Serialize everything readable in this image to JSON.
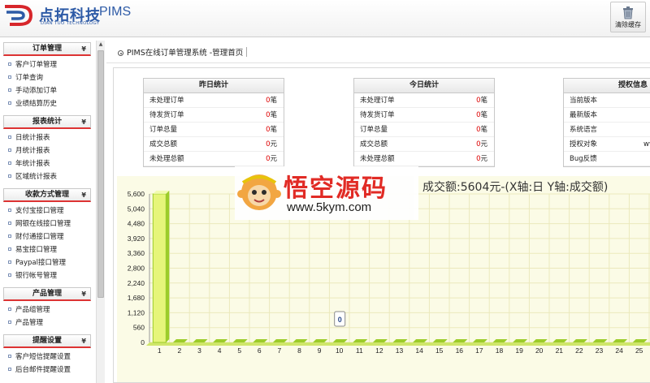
{
  "header": {
    "logo_cn": "点拓科技",
    "logo_pims": "PIMS",
    "logo_en": "DIAN TUO TECHNOLOGY",
    "clear_cache_label": "清除缓存"
  },
  "sidebar": {
    "menus": [
      {
        "title": "订单管理",
        "items": [
          "客户订单管理",
          "订单查询",
          "手动添加订单",
          "业绩结算历史"
        ]
      },
      {
        "title": "报表统计",
        "items": [
          "日统计报表",
          "月统计报表",
          "年统计报表",
          "区域统计报表"
        ]
      },
      {
        "title": "收款方式管理",
        "items": [
          "支付宝接口管理",
          "网银在线接口管理",
          "财付通接口管理",
          "易宝接口管理",
          "Paypal接口管理",
          "银行帐号管理"
        ]
      },
      {
        "title": "产品管理",
        "items": [
          "产品组管理",
          "产品管理"
        ]
      },
      {
        "title": "提醒设置",
        "items": [
          "客户短信提醒设置",
          "后台邮件提醒设置"
        ]
      }
    ]
  },
  "main": {
    "breadcrumb": "PIMS在线订单管理系统 -管理首页",
    "yesterday": {
      "title": "昨日统计",
      "rows": [
        {
          "label": "未处理订单",
          "num": "0",
          "unit": "笔"
        },
        {
          "label": "待发货订单",
          "num": "0",
          "unit": "笔"
        },
        {
          "label": "订单总量",
          "num": "0",
          "unit": "笔"
        },
        {
          "label": "成交总额",
          "num": "0",
          "unit": "元"
        },
        {
          "label": "未处理总额",
          "num": "0",
          "unit": "元"
        }
      ]
    },
    "today": {
      "title": "今日统计",
      "rows": [
        {
          "label": "未处理订单",
          "num": "0",
          "unit": "笔"
        },
        {
          "label": "待发货订单",
          "num": "0",
          "unit": "笔"
        },
        {
          "label": "订单总量",
          "num": "0",
          "unit": "笔"
        },
        {
          "label": "成交总额",
          "num": "0",
          "unit": "元"
        },
        {
          "label": "未处理总额",
          "num": "0",
          "unit": "元"
        }
      ]
    },
    "license": {
      "title": "授权信息",
      "rows": [
        {
          "label": "当前版本",
          "value": ""
        },
        {
          "label": "最新版本",
          "value": ""
        },
        {
          "label": "系统语言",
          "value": ""
        },
        {
          "label": "授权对象",
          "value": "ww"
        },
        {
          "label": "Bug反馈",
          "value": ""
        }
      ]
    }
  },
  "watermark": {
    "cn": "悟空源码",
    "url": "www.5kym.com"
  },
  "chart_data": {
    "type": "bar",
    "title": "成交额:5604元-(X轴:日  Y轴:成交额)",
    "x_label": "日",
    "y_label": "成交额",
    "categories": [
      "1",
      "2",
      "3",
      "4",
      "5",
      "6",
      "7",
      "8",
      "9",
      "10",
      "11",
      "12",
      "13",
      "14",
      "15",
      "16",
      "17",
      "18",
      "19",
      "20",
      "21",
      "22",
      "23",
      "24",
      "25"
    ],
    "values": [
      5604,
      0,
      0,
      0,
      0,
      0,
      0,
      0,
      0,
      0,
      0,
      0,
      0,
      0,
      0,
      0,
      0,
      0,
      0,
      0,
      0,
      0,
      0,
      0,
      0
    ],
    "y_ticks": [
      "0",
      "560",
      "1,120",
      "1,680",
      "2,240",
      "2,800",
      "3,360",
      "3,920",
      "4,480",
      "5,040",
      "5,600"
    ],
    "ylim": [
      0,
      5600
    ],
    "tooltip_value": "0",
    "tooltip_category": "10",
    "colors": {
      "bar_light": "#e6f57a",
      "bar_dark": "#9ccc2a",
      "grid": "#ebe9bc",
      "background": "#fbfbe6"
    }
  }
}
